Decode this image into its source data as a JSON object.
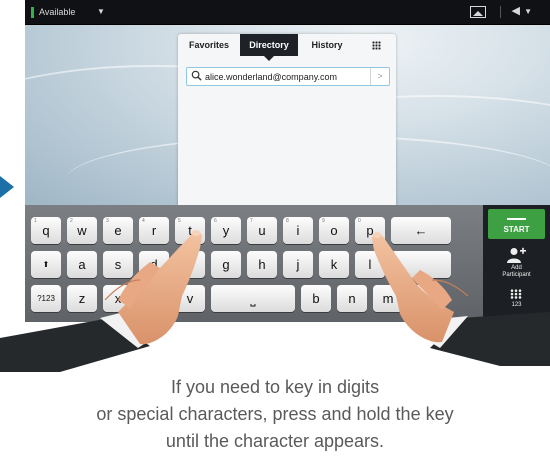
{
  "status_bar": {
    "presence": "Available"
  },
  "directory": {
    "tabs": [
      "Favorites",
      "Directory",
      "History"
    ],
    "active_tab": "Directory",
    "search_value": "alice.wonderland@company.com"
  },
  "keyboard": {
    "row1": [
      {
        "k": "q",
        "d": "1"
      },
      {
        "k": "w",
        "d": "2"
      },
      {
        "k": "e",
        "d": "3"
      },
      {
        "k": "r",
        "d": "4"
      },
      {
        "k": "t",
        "d": "5"
      },
      {
        "k": "y",
        "d": "6"
      },
      {
        "k": "u",
        "d": "7"
      },
      {
        "k": "i",
        "d": "8"
      },
      {
        "k": "o",
        "d": "9"
      },
      {
        "k": "p",
        "d": "0"
      }
    ],
    "backspace": "←",
    "row2": [
      "a",
      "s",
      "d",
      "f",
      "g",
      "h",
      "j",
      "k",
      "l"
    ],
    "shift": "⬆",
    "row3": [
      "z",
      "x",
      "c",
      "v",
      "b",
      "n",
      "m"
    ],
    "symbols": "?123",
    "space": "⎵",
    "period": "."
  },
  "actions": {
    "start": "START",
    "add_participant": [
      "Add",
      "Participant"
    ],
    "keypad": "123"
  },
  "caption": [
    "If you need to key in digits",
    "or special characters, press and hold the key",
    "until the character appears."
  ],
  "colors": {
    "start": "#3da144",
    "screen": "#1e2227",
    "presence": "#2fb34a"
  }
}
